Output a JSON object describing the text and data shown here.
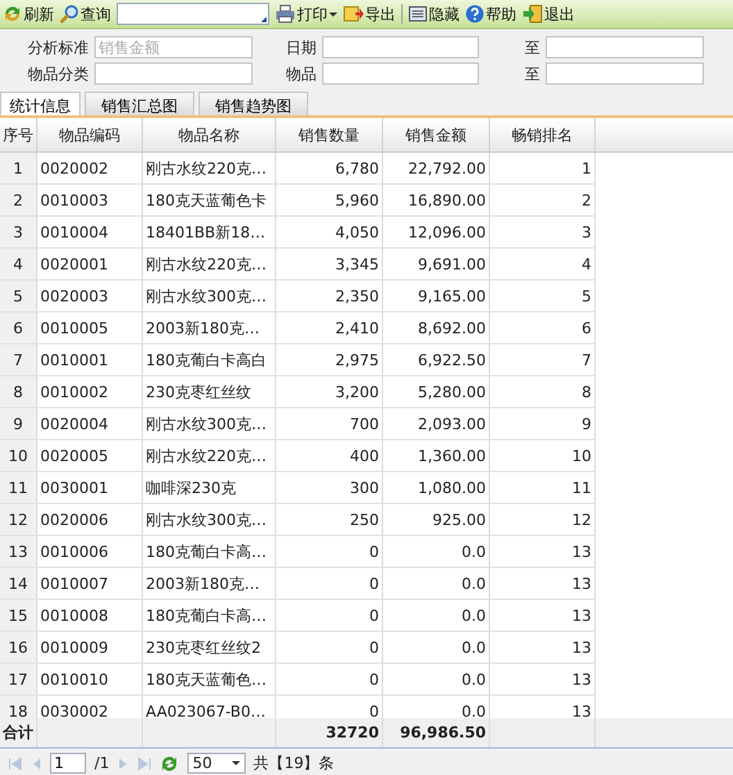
{
  "toolbar": [
    {
      "kind": "button",
      "label": "刷新"
    },
    {
      "kind": "button",
      "label": "查询"
    },
    {
      "kind": "field"
    },
    {
      "kind": "dropdown",
      "label": "打印"
    },
    {
      "kind": "button",
      "label": "导出"
    },
    {
      "kind": "separator"
    },
    {
      "kind": "button",
      "label": "隐藏"
    },
    {
      "kind": "button",
      "label": "帮助"
    },
    {
      "kind": "button",
      "label": "退出"
    }
  ],
  "filters": [
    {
      "label": "分析标准",
      "placeholder": "销售金额"
    },
    {
      "label": "日期"
    },
    {
      "label": "至"
    },
    {
      "label": "物品分类"
    },
    {
      "label": "物品"
    },
    {
      "label": "至"
    }
  ],
  "tabs": [
    {
      "label": "统计信息",
      "selected": true
    },
    {
      "label": "销售汇总图",
      "selected": false
    },
    {
      "label": "销售趋势图",
      "selected": false
    }
  ],
  "table": {
    "columns": [
      "序号",
      "物品编码",
      "物品名称",
      "销售数量",
      "销售金额",
      "畅销排名"
    ],
    "rows": [
      [
        "1",
        "0020002",
        "刚古水纹220克…",
        "6,780",
        "22,792.00",
        "1"
      ],
      [
        "2",
        "0010003",
        "180克天蓝葡色卡",
        "5,960",
        "16,890.00",
        "2"
      ],
      [
        "3",
        "0010004",
        "18401BB新18…",
        "4,050",
        "12,096.00",
        "3"
      ],
      [
        "4",
        "0020001",
        "刚古水纹220克…",
        "3,345",
        "9,691.00",
        "4"
      ],
      [
        "5",
        "0020003",
        "刚古水纹300克…",
        "2,350",
        "9,165.00",
        "5"
      ],
      [
        "6",
        "0010005",
        "2003新180克…",
        "2,410",
        "8,692.00",
        "6"
      ],
      [
        "7",
        "0010001",
        "180克葡白卡高白",
        "2,975",
        "6,922.50",
        "7"
      ],
      [
        "8",
        "0010002",
        "230克枣红丝纹",
        "3,200",
        "5,280.00",
        "8"
      ],
      [
        "9",
        "0020004",
        "刚古水纹300克…",
        "700",
        "2,093.00",
        "9"
      ],
      [
        "10",
        "0020005",
        "刚古水纹220克…",
        "400",
        "1,360.00",
        "10"
      ],
      [
        "11",
        "0030001",
        "咖啡深230克",
        "300",
        "1,080.00",
        "11"
      ],
      [
        "12",
        "0020006",
        "刚古水纹300克…",
        "250",
        "925.00",
        "12"
      ],
      [
        "13",
        "0010006",
        "180克葡白卡高…",
        "0",
        "0.0",
        "13"
      ],
      [
        "14",
        "0010007",
        "2003新180克…",
        "0",
        "0.0",
        "13"
      ],
      [
        "15",
        "0010008",
        "180克葡白卡高…",
        "0",
        "0.0",
        "13"
      ],
      [
        "16",
        "0010009",
        "230克枣红丝纹2",
        "0",
        "0.0",
        "13"
      ],
      [
        "17",
        "0010010",
        "180克天蓝葡色…",
        "0",
        "0.0",
        "13"
      ],
      [
        "18",
        "0030002",
        "AA023067-B0…",
        "0",
        "0.0",
        "13"
      ]
    ],
    "footer": {
      "label": "合计",
      "quantity": "32720",
      "amount": "96,986.50"
    }
  },
  "pager": {
    "page": "1",
    "pages": "/1",
    "page_size": "50",
    "total": "共【19】条"
  }
}
